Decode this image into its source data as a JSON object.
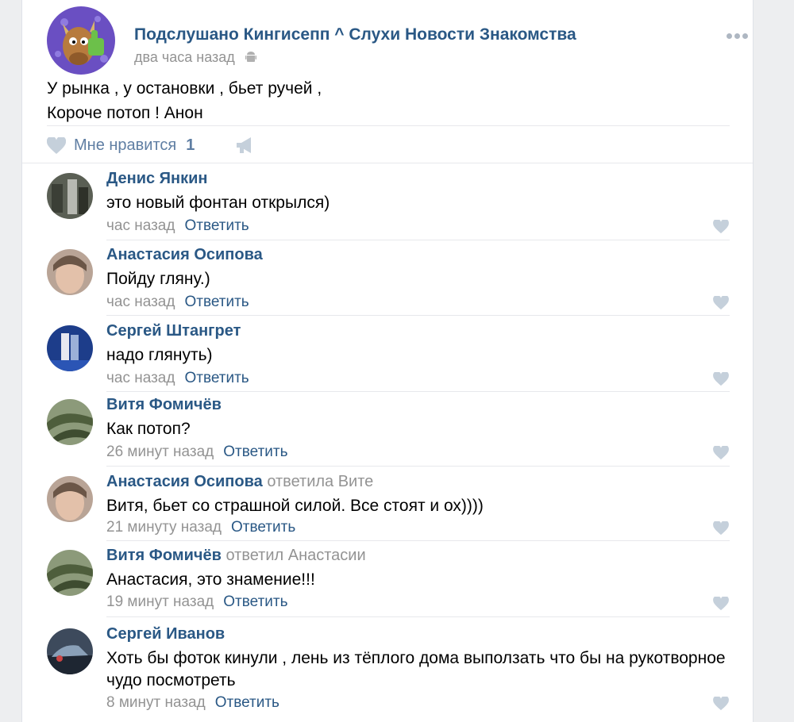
{
  "post": {
    "group_name": "Подслушано Кингисепп ^ Слухи Новости Знакомства",
    "time": "два часа назад",
    "text_lines": [
      "У рынка , у остановки , бьет ручей ,",
      "Короче потоп ! Анон"
    ],
    "like_label": "Мне нравится",
    "like_count": "1",
    "icons": {
      "more": "more-dots-icon",
      "device": "android-icon",
      "like": "heart-icon",
      "share": "megaphone-icon"
    }
  },
  "comments": [
    {
      "author": "Денис Янкин",
      "reply_to": "",
      "text": "это новый фонтан открылся)",
      "time": "час назад",
      "reply_label": "Ответить"
    },
    {
      "author": "Анастасия Осипова",
      "reply_to": "",
      "text": "Пойду гляну.)",
      "time": "час назад",
      "reply_label": "Ответить"
    },
    {
      "author": "Сергей Штангрет",
      "reply_to": "",
      "text": "надо глянуть)",
      "time": "час назад",
      "reply_label": "Ответить"
    },
    {
      "author": "Витя Фомичёв",
      "reply_to": "",
      "text": "Как потоп?",
      "time": "26 минут назад",
      "reply_label": "Ответить"
    },
    {
      "author": "Анастасия Осипова",
      "reply_to": "ответила Вите",
      "text": "Витя, бьет со страшной силой. Все стоят и ох))))",
      "time": "21 минуту назад",
      "reply_label": "Ответить"
    },
    {
      "author": "Витя Фомичёв",
      "reply_to": "ответил Анастасии",
      "text": "Анастасия, это знамение!!!",
      "time": "19 минут назад",
      "reply_label": "Ответить"
    },
    {
      "author": "Сергей Иванов",
      "reply_to": "",
      "text": "Хоть бы фоток кинули , лень из тёплого дома выползать что бы на рукотворное чудо посмотреть",
      "time": "8 минут назад",
      "reply_label": "Ответить"
    }
  ],
  "colors": {
    "link": "#2a5885",
    "muted": "#939393",
    "like": "#5f7ea3",
    "icon": "#c5d0db"
  }
}
